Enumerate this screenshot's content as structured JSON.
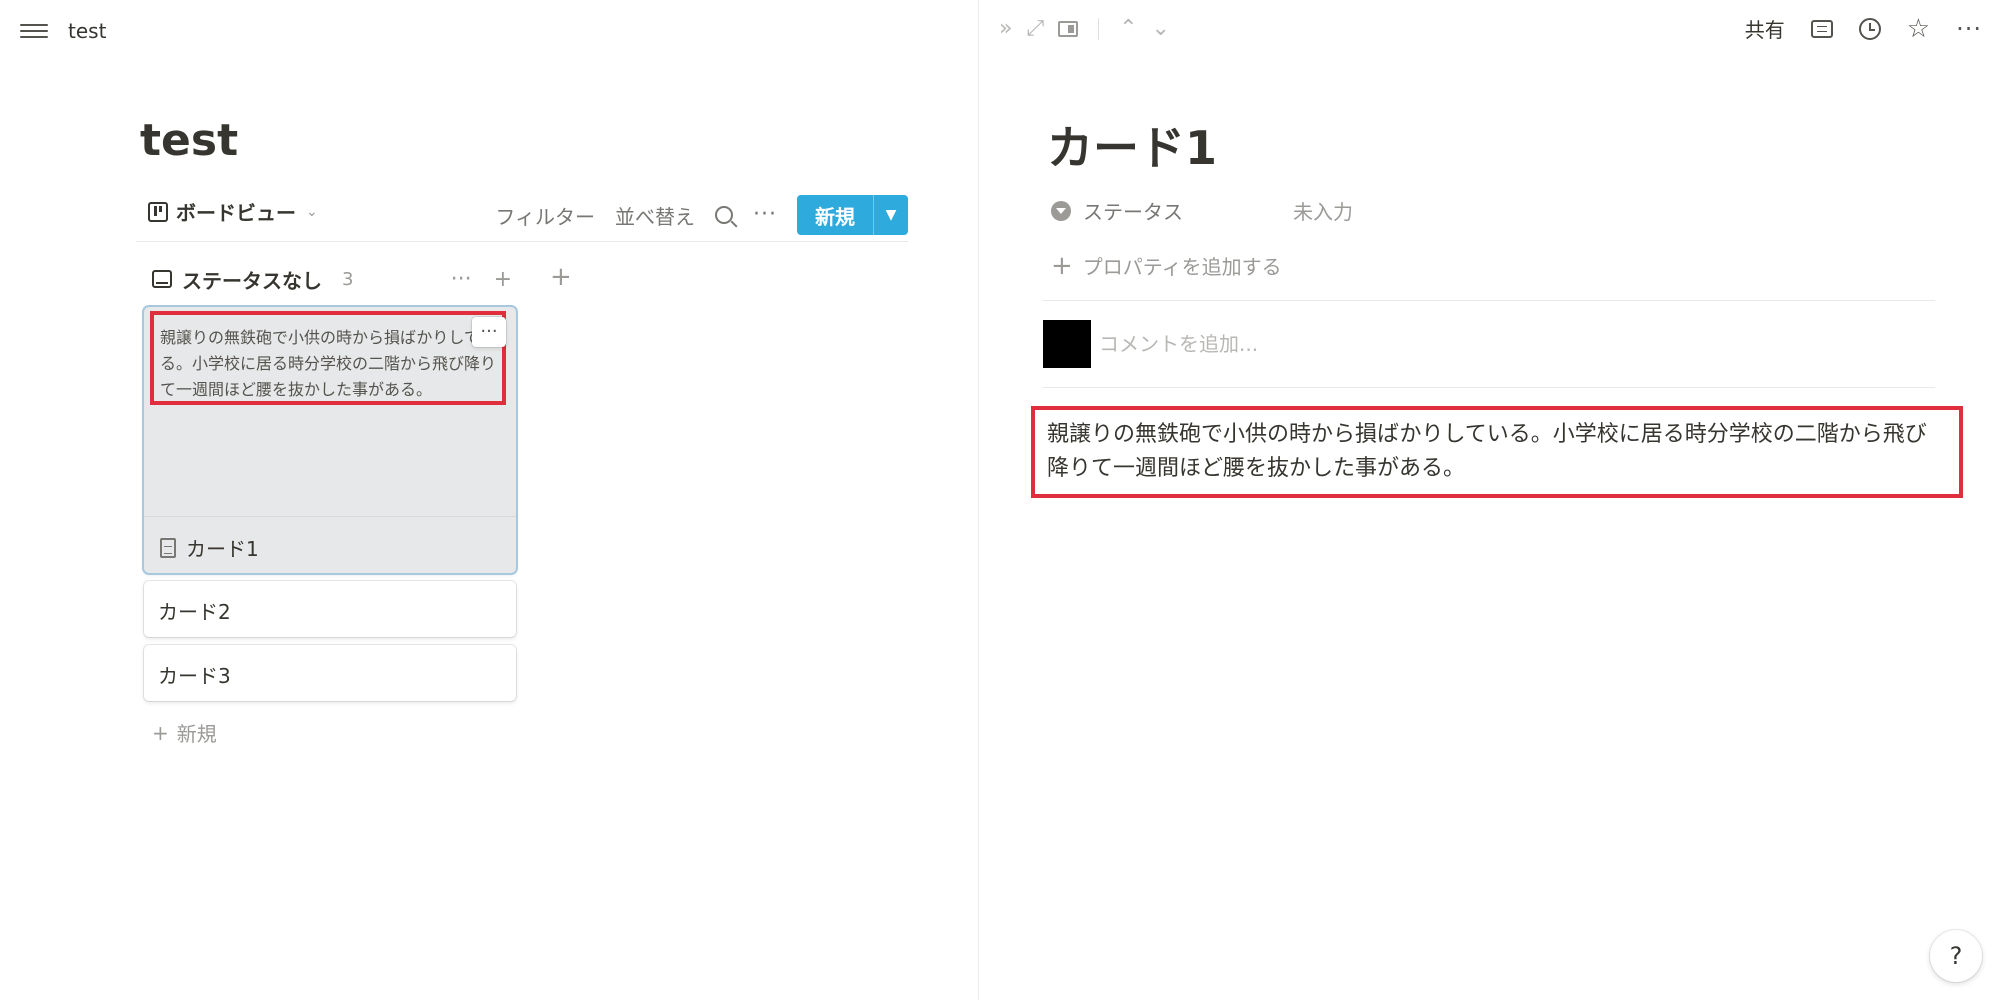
{
  "breadcrumb": "test",
  "page": {
    "title": "test"
  },
  "view": {
    "name": "ボードビュー"
  },
  "toolbar": {
    "filter": "フィルター",
    "sort": "並べ替え",
    "new_label": "新規"
  },
  "group": {
    "title": "ステータスなし",
    "count": "3",
    "add_card": "新規"
  },
  "cards": [
    {
      "title": "カード1",
      "preview": "親譲りの無鉄砲で小供の時から損ばかりしている。小学校に居る時分学校の二階から飛び降りて一週間ほど腰を抜かした事がある。"
    },
    {
      "title": "カード2"
    },
    {
      "title": "カード3"
    }
  ],
  "peek": {
    "share": "共有",
    "title": "カード1",
    "properties": [
      {
        "name": "ステータス",
        "value": "未入力"
      }
    ],
    "add_property": "プロパティを追加する",
    "comment_placeholder": "コメントを追加...",
    "body": "親譲りの無鉄砲で小供の時から損ばかりしている。小学校に居る時分学校の二階から飛び降りて一週間ほど腰を抜かした事がある。"
  },
  "help": "?",
  "colors": {
    "accent": "#2eaadc",
    "highlight": "#e02e3c",
    "text": "#37352f",
    "muted": "#9b9a97"
  }
}
